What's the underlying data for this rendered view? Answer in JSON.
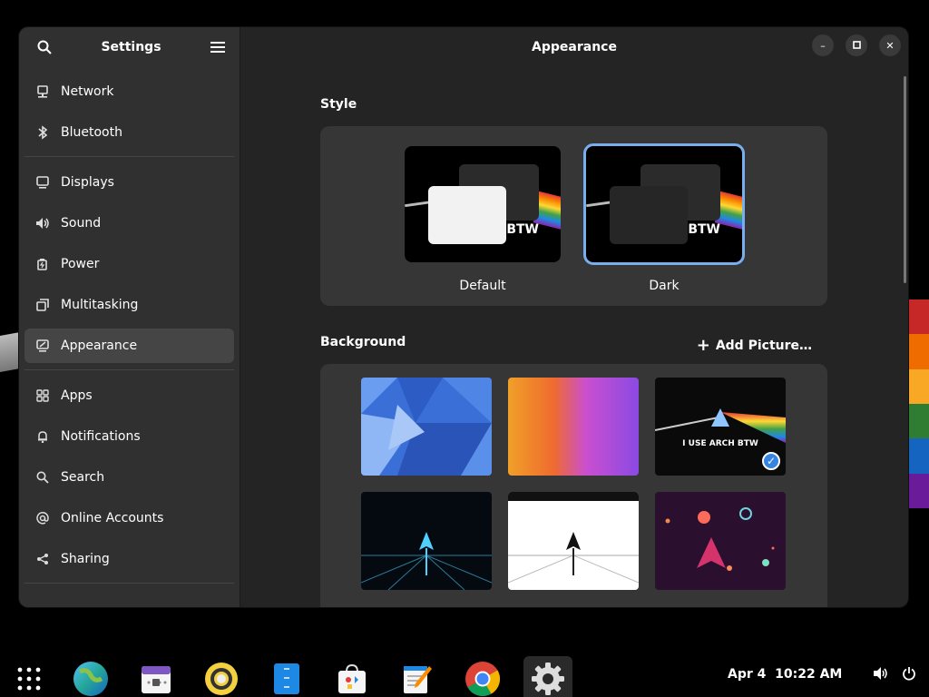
{
  "sidebar": {
    "title": "Settings",
    "groups": [
      [
        {
          "label": "Network",
          "icon": "network-icon"
        },
        {
          "label": "Bluetooth",
          "icon": "bluetooth-icon"
        }
      ],
      [
        {
          "label": "Displays",
          "icon": "display-icon"
        },
        {
          "label": "Sound",
          "icon": "sound-icon"
        },
        {
          "label": "Power",
          "icon": "power-icon"
        },
        {
          "label": "Multitasking",
          "icon": "multitasking-icon"
        },
        {
          "label": "Appearance",
          "icon": "appearance-icon",
          "active": true
        }
      ],
      [
        {
          "label": "Apps",
          "icon": "apps-icon"
        },
        {
          "label": "Notifications",
          "icon": "bell-icon"
        },
        {
          "label": "Search",
          "icon": "search-icon"
        },
        {
          "label": "Online Accounts",
          "icon": "at-icon"
        },
        {
          "label": "Sharing",
          "icon": "share-icon"
        }
      ]
    ]
  },
  "main": {
    "title": "Appearance",
    "style_label": "Style",
    "style_options": [
      {
        "label": "Default",
        "text": "BTW"
      },
      {
        "label": "Dark",
        "text": "BTW",
        "selected": true
      }
    ],
    "background_label": "Background",
    "add_picture_label": "Add Picture…",
    "wallpaper_text": "I USE ARCH BTW"
  },
  "taskbar": {
    "date": "Apr 4",
    "time": "10:22 AM"
  },
  "colors": {
    "accent": "#78aeed",
    "window_bg": "#242424",
    "sidebar_bg": "#303030",
    "panel_bg": "#363636"
  }
}
